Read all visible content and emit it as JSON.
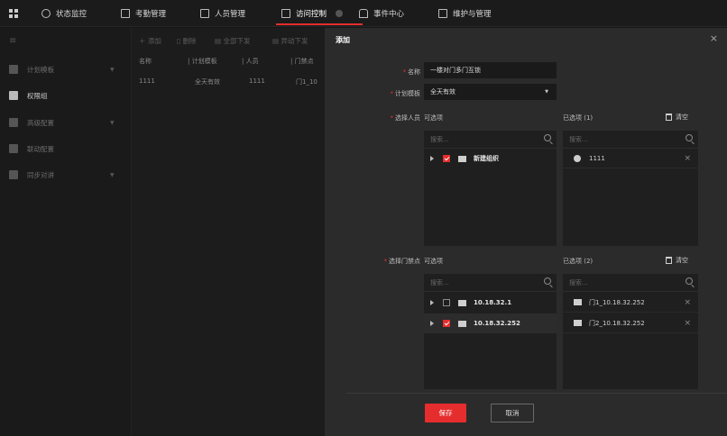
{
  "topbar": {
    "tabs": [
      {
        "label": "状态监控",
        "icon": "monitor-icon"
      },
      {
        "label": "考勤管理",
        "icon": "calendar-icon"
      },
      {
        "label": "人员管理",
        "icon": "person-card-icon"
      },
      {
        "label": "访问控制",
        "icon": "door-icon",
        "active": true
      },
      {
        "label": "事件中心",
        "icon": "bank-icon"
      },
      {
        "label": "维护与管理",
        "icon": "maintenance-icon"
      }
    ],
    "accent": "#e52d2d"
  },
  "sidebar": {
    "items": [
      {
        "label": "计划模板",
        "icon": "template-icon",
        "has_arrow": true
      },
      {
        "label": "权限组",
        "icon": "group-icon",
        "active": true
      },
      {
        "label": "高级配置",
        "icon": "config-icon",
        "has_arrow": true
      },
      {
        "label": "联动配置",
        "icon": "linkage-icon"
      },
      {
        "label": "同步对讲",
        "icon": "intercom-icon",
        "has_arrow": true
      }
    ]
  },
  "list": {
    "toolbar": [
      "添加",
      "删除",
      "全部下发",
      "异动下发"
    ],
    "columns": [
      "名称",
      "计划模板",
      "人员",
      "门禁点"
    ],
    "rows": [
      [
        "1111",
        "全天有效",
        "1111",
        "门1_10"
      ]
    ]
  },
  "modal": {
    "title": "添加",
    "name_label": "名称",
    "name_value": "一楼对门多门互锁",
    "template_label": "计划模板",
    "template_value": "全天有效",
    "person_label": "选择人员",
    "available_label": "可选项",
    "selected_persons_label": "已选项 (1)",
    "clear_label": "清空",
    "search_placeholder": "搜索...",
    "person_tree": [
      {
        "label": "新建组织",
        "checked": true
      }
    ],
    "selected_persons": [
      "1111"
    ],
    "door_label": "选择门禁点",
    "selected_doors_label": "已选项 (2)",
    "door_tree": [
      {
        "label": "10.18.32.1",
        "checked": false
      },
      {
        "label": "10.18.32.252",
        "checked": true
      }
    ],
    "selected_doors": [
      "门1_10.18.32.252",
      "门2_10.18.32.252"
    ],
    "save_label": "保存",
    "cancel_label": "取消"
  }
}
